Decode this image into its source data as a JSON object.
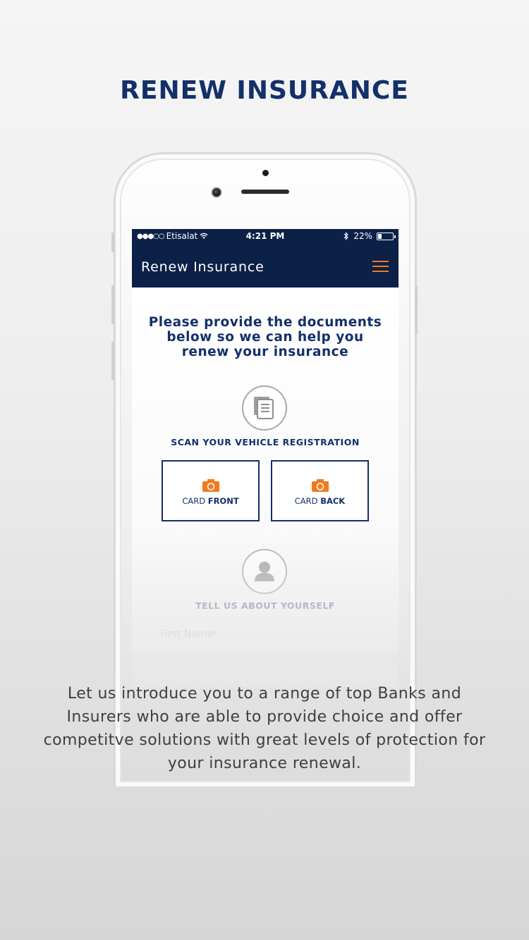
{
  "promo": {
    "title": "RENEW INSURANCE",
    "body": "Let us introduce you to a range of top Banks and Insurers who are able to provide choice and offer competitve solutions with great levels of protection for your insurance renewal."
  },
  "status_bar": {
    "signal": "●●●○○",
    "carrier": "Etisalat",
    "time": "4:21 PM",
    "battery": "22%",
    "battery_level": 0.22
  },
  "app": {
    "nav_title": "Renew Insurance",
    "intro": "Please provide the documents below so we can help you renew your insurance",
    "scan_section": {
      "icon": "document-icon",
      "label": "SCAN YOUR VEHICLE REGISTRATION",
      "front": {
        "prefix": "CARD ",
        "bold": "FRONT",
        "icon": "camera-icon"
      },
      "back": {
        "prefix": "CARD ",
        "bold": "BACK",
        "icon": "camera-icon"
      }
    },
    "about_section": {
      "icon": "person-icon",
      "label": "TELL US ABOUT YOURSELF",
      "first_name_placeholder": "First Name*"
    }
  },
  "colors": {
    "brand_navy": "#13306a",
    "nav_bg": "#0c2147",
    "accent_orange": "#f07a1f"
  }
}
